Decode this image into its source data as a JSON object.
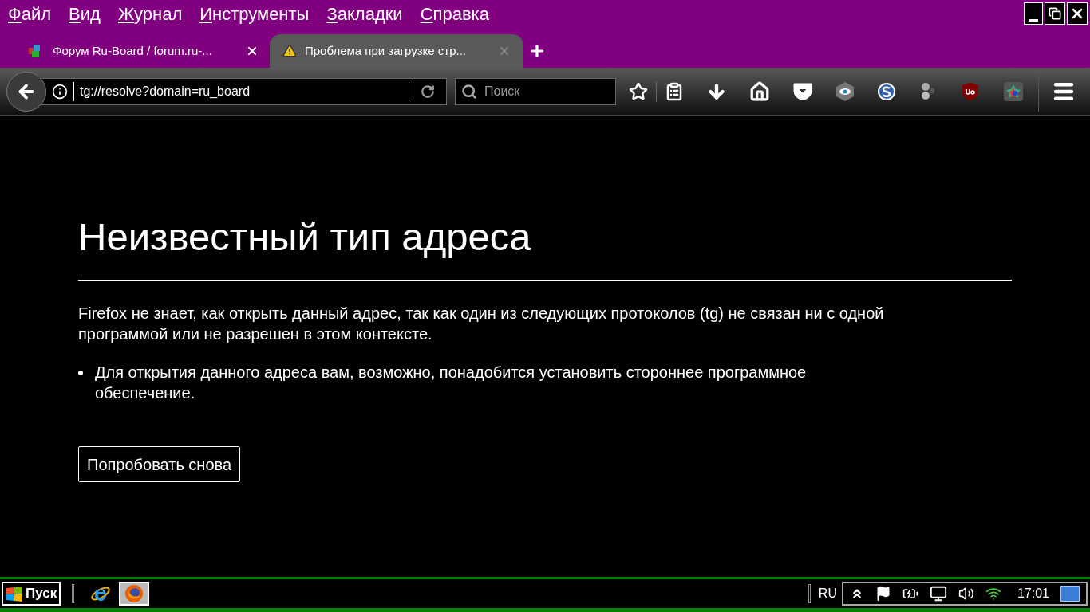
{
  "menu": [
    "Файл",
    "Вид",
    "Журнал",
    "Инструменты",
    "Закладки",
    "Справка"
  ],
  "tabs": [
    {
      "title": "Форум Ru-Board / forum.ru-...",
      "selected": false,
      "kind": "site"
    },
    {
      "title": "Проблема при загрузке стр...",
      "selected": true,
      "kind": "warning"
    }
  ],
  "address_bar": {
    "value": "tg://resolve?domain=ru_board"
  },
  "search": {
    "placeholder": "Поиск"
  },
  "error_page": {
    "title": "Неизвестный тип адреса",
    "description": "Firefox не знает, как открыть данный адрес, так как один из следующих протоколов (tg) не связан ни с одной программой или не разрешен в этом контексте.",
    "bullets": [
      "Для открытия данного адреса вам, возможно, понадобится установить стороннее программное обеспечение."
    ],
    "button": "Попробовать снова"
  },
  "taskbar": {
    "start": "Пуск",
    "language": "RU",
    "clock": "17:01"
  }
}
